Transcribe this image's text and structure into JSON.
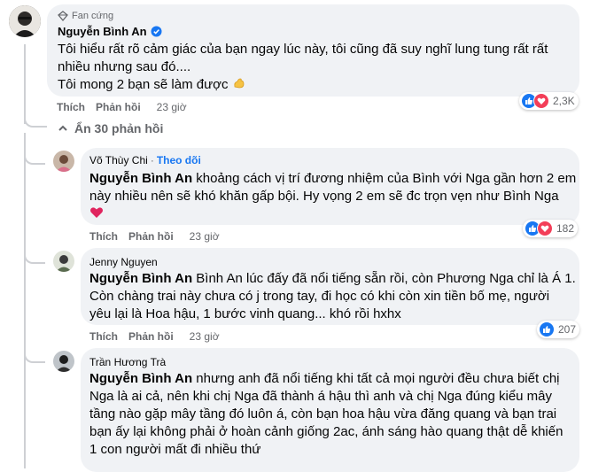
{
  "main_comment": {
    "badge": "Fan cứng",
    "author": "Nguyễn Bình An",
    "lines": [
      "Tôi hiểu rất rõ cảm giác của bạn ngay lúc này, tôi cũng đã suy nghĩ lung tung rất rất",
      "nhiều nhưng sau đó....",
      "Tôi mong 2 bạn sẽ làm được"
    ],
    "like_label": "Thích",
    "reply_label": "Phản hồi",
    "time": "23 giờ",
    "reaction_count": "2,3K"
  },
  "hide_replies_label": "Ẩn 30 phản hồi",
  "replies": [
    {
      "author": "Võ Thùy Chi",
      "follow": "Theo dõi",
      "mention": "Nguyễn Bình An",
      "lines": [
        " khoảng cách vị trí đương nhiệm của Bình với Nga gần hơn 2 em",
        "này nhiều nên sẽ khó khăn gấp bội. Hy vọng 2 em sẽ đc trọn vẹn như Bình Nga"
      ],
      "like_label": "Thích",
      "reply_label": "Phản hồi",
      "time": "23 giờ",
      "reaction_count": "182"
    },
    {
      "author": "Jenny Nguyen",
      "mention": "Nguyễn Bình An",
      "lines": [
        " Bình An lúc đấy đã nổi tiếng sẵn rồi, còn Phương Nga chỉ là Á 1.",
        "Còn chàng trai này chưa có j trong tay, đi học có khi còn xin tiền bố mẹ, người",
        "yêu lại là Hoa hậu, 1 bước vinh quang... khó rồi hxhx"
      ],
      "like_label": "Thích",
      "reply_label": "Phản hồi",
      "time": "23 giờ",
      "reaction_count": "207"
    },
    {
      "author": "Trần Hương Trà",
      "mention": "Nguyễn Bình An",
      "lines": [
        " nhưng anh đã nổi tiếng khi tất cả mọi người đều chưa biết chị",
        "Nga là ai cả, nên khi chị Nga đã thành á hậu thì anh và chị Nga đúng kiểu mây",
        "tầng nào gặp mây tầng đó luôn á, còn bạn hoa hậu vừa đăng quang và bạn trai",
        "bạn ấy lại không phải ở hoàn cảnh giống 2ac, ánh sáng hào quang thật dễ khiến",
        "1 con người mất đi nhiều thứ"
      ]
    }
  ],
  "colors": {
    "bubble": "#f0f2f5",
    "like": "#1877f2",
    "love": "#f33e58",
    "verified": "#1877f2"
  },
  "icons": [
    "fan-badge-icon",
    "verified-icon",
    "muscle-emoji-icon",
    "heart-emoji-icon",
    "like-reaction-icon",
    "love-reaction-icon",
    "chevron-up-icon"
  ]
}
